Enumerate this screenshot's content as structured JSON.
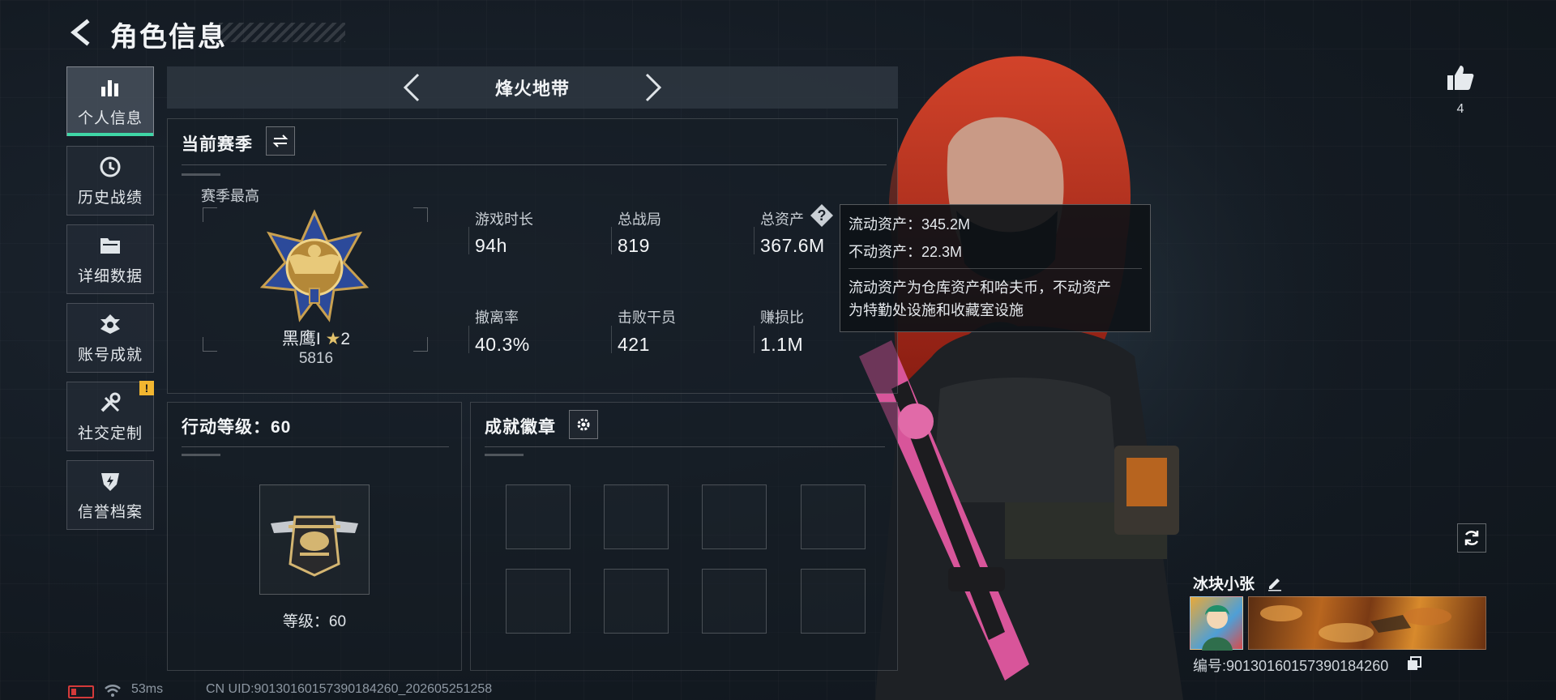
{
  "header": {
    "title": "角色信息"
  },
  "sidebar": {
    "items": [
      {
        "label": "个人信息",
        "icon": "bar-chart-icon",
        "active": true
      },
      {
        "label": "历史战绩",
        "icon": "history-clock-icon"
      },
      {
        "label": "详细数据",
        "icon": "folder-icon"
      },
      {
        "label": "账号成就",
        "icon": "achievement-icon"
      },
      {
        "label": "社交定制",
        "icon": "tools-icon",
        "badge": "!"
      },
      {
        "label": "信誉档案",
        "icon": "shield-bolt-icon"
      }
    ]
  },
  "mode": {
    "title": "烽火地带"
  },
  "season": {
    "section_title": "当前赛季",
    "best_label": "赛季最高",
    "rank_name": "黑鹰I",
    "rank_stars": "2",
    "rank_points": "5816",
    "stats": [
      {
        "label": "游戏时长",
        "value": "94h"
      },
      {
        "label": "总战局",
        "value": "819"
      },
      {
        "label": "总资产",
        "value": "367.6M",
        "help": true
      },
      {
        "label": "撤离率",
        "value": "40.3%"
      },
      {
        "label": "击败干员",
        "value": "421"
      },
      {
        "label": "赚损比",
        "value": "1.1M"
      }
    ]
  },
  "tooltip": {
    "liquid": "流动资产：345.2M",
    "fixed": "不动资产：22.3M",
    "desc_line1": "流动资产为仓库资产和哈夫币，不动资产",
    "desc_line2": "为特勤处设施和收藏室设施"
  },
  "action_level": {
    "title": "行动等级：60",
    "level_label": "等级：60"
  },
  "badges": {
    "title": "成就徽章",
    "slots": 8
  },
  "profile": {
    "likes": "4",
    "name": "冰块小张",
    "id_label": "编号:90130160157390184260"
  },
  "status_bar": {
    "ping": "53ms",
    "uid": "CN UID:90130160157390184260_202605251258"
  },
  "colors": {
    "accent": "#3fd6a6",
    "warning": "#f2b630",
    "hair": "#c2301e",
    "weapon": "#e0569c"
  }
}
